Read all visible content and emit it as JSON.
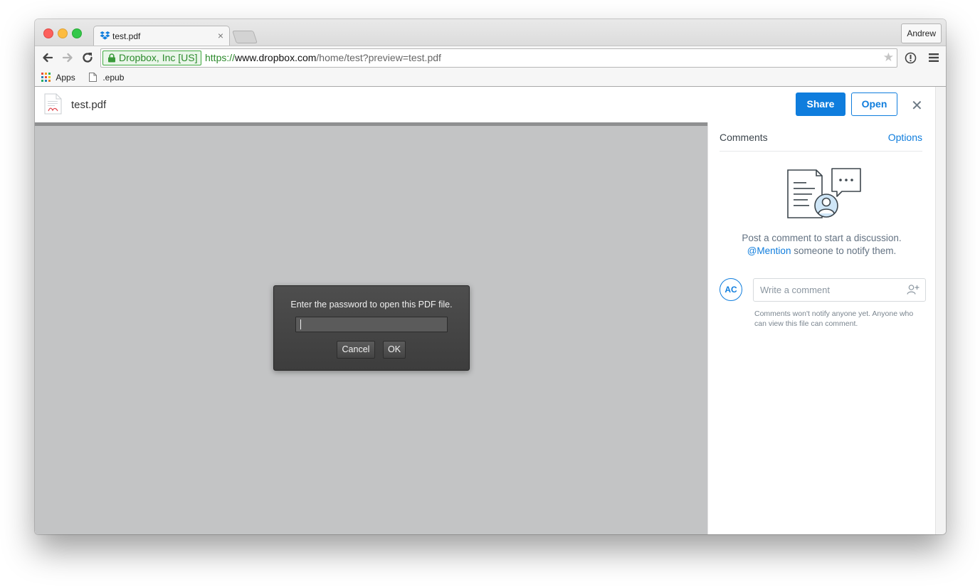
{
  "browser": {
    "tab_title": "test.pdf",
    "tab_close": "×",
    "profile_name": "Andrew",
    "ev_label": "Dropbox, Inc [US]",
    "url_scheme": "https://",
    "url_host": "www.dropbox.com",
    "url_path": "/home/test?preview=test.pdf",
    "bookmarks": [
      {
        "label": "Apps",
        "icon": "apps-grid-icon"
      },
      {
        "label": ".epub",
        "icon": "page-icon"
      }
    ]
  },
  "header": {
    "file_name": "test.pdf",
    "share_label": "Share",
    "open_label": "Open",
    "close_glyph": "✕"
  },
  "dialog": {
    "prompt": "Enter the password to open this PDF file.",
    "cancel_label": "Cancel",
    "ok_label": "OK"
  },
  "comments": {
    "title": "Comments",
    "options_label": "Options",
    "hint_line1": "Post a comment to start a discussion.",
    "hint_mention": "@Mention",
    "hint_line2_rest": " someone to notify them.",
    "avatar_initials": "AC",
    "input_placeholder": "Write a comment",
    "note": "Comments won't notify anyone yet. Anyone who can view this file can comment."
  },
  "colors": {
    "accent": "#0f7ddd",
    "viewer_bg": "#c3c4c5",
    "dialog_bg": "#444444"
  }
}
